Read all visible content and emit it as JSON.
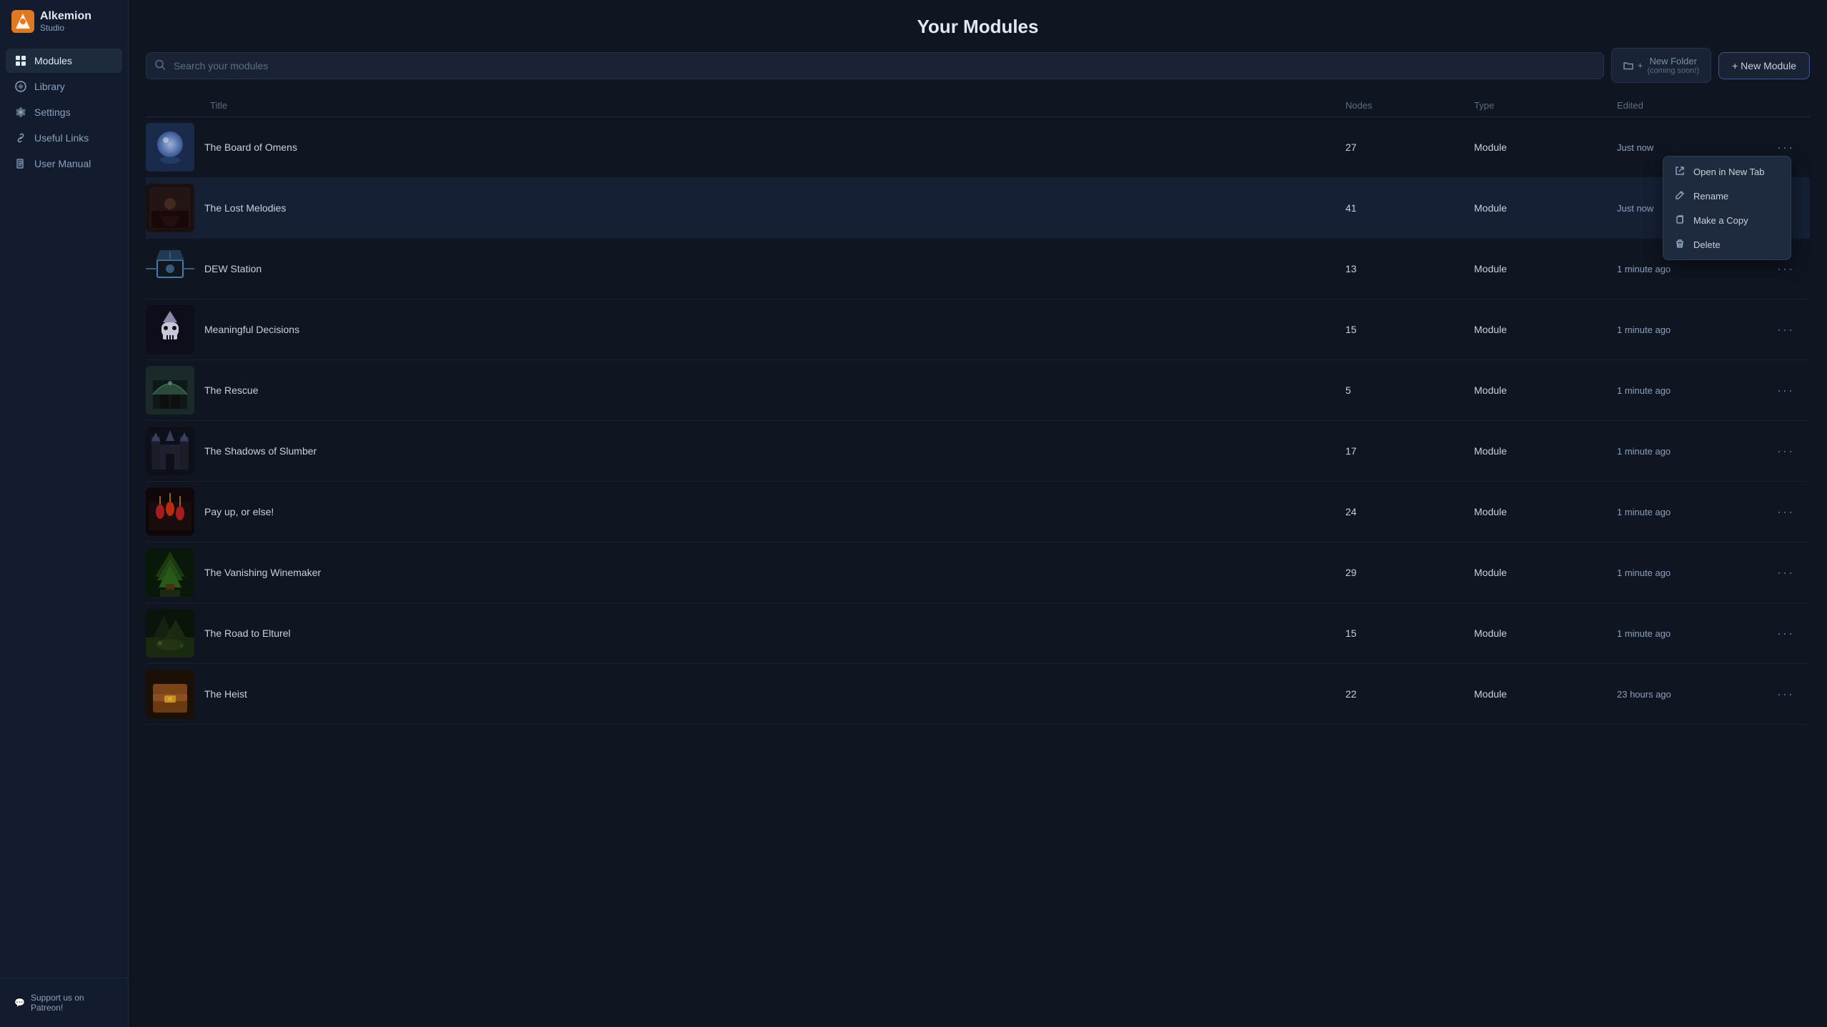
{
  "app": {
    "name": "Alkemion",
    "subtitle": "Studio"
  },
  "sidebar": {
    "items": [
      {
        "id": "modules",
        "label": "Modules",
        "icon": "⊞",
        "active": true
      },
      {
        "id": "library",
        "label": "Library",
        "icon": "📚",
        "active": false
      },
      {
        "id": "settings",
        "label": "Settings",
        "icon": "⚙",
        "active": false
      },
      {
        "id": "useful-links",
        "label": "Useful Links",
        "icon": "🔗",
        "active": false
      },
      {
        "id": "user-manual",
        "label": "User Manual",
        "icon": "📖",
        "active": false
      }
    ],
    "support_label": "Support us on Patreon!"
  },
  "page": {
    "title": "Your Modules"
  },
  "search": {
    "placeholder": "Search your modules"
  },
  "toolbar": {
    "new_folder_label": "New Folder",
    "new_folder_sublabel": "(coming soon!)",
    "new_module_label": "+ New Module"
  },
  "table": {
    "columns": [
      "Title",
      "Nodes",
      "Type",
      "Edited"
    ],
    "rows": [
      {
        "id": 1,
        "title": "The Board of Omens",
        "nodes": 27,
        "type": "Module",
        "edited": "Just now",
        "thumb_type": "crystal_ball",
        "selected": false
      },
      {
        "id": 2,
        "title": "The Lost Melodies",
        "nodes": 41,
        "type": "Module",
        "edited": "Just now",
        "thumb_type": "photo_dark",
        "selected": true
      },
      {
        "id": 3,
        "title": "DEW Station",
        "nodes": 13,
        "type": "Module",
        "edited": "1 minute ago",
        "thumb_type": "satellite",
        "selected": false
      },
      {
        "id": 4,
        "title": "Meaningful Decisions",
        "nodes": 15,
        "type": "Module",
        "edited": "1 minute ago",
        "thumb_type": "skull_crown",
        "selected": false
      },
      {
        "id": 5,
        "title": "The Rescue",
        "nodes": 5,
        "type": "Module",
        "edited": "1 minute ago",
        "thumb_type": "gate_arch",
        "selected": false
      },
      {
        "id": 6,
        "title": "The Shadows of Slumber",
        "nodes": 17,
        "type": "Module",
        "edited": "1 minute ago",
        "thumb_type": "dark_castle",
        "selected": false
      },
      {
        "id": 7,
        "title": "Pay up, or else!",
        "nodes": 24,
        "type": "Module",
        "edited": "1 minute ago",
        "thumb_type": "red_lanterns",
        "selected": false
      },
      {
        "id": 8,
        "title": "The Vanishing Winemaker",
        "nodes": 29,
        "type": "Module",
        "edited": "1 minute ago",
        "thumb_type": "forest_path",
        "selected": false
      },
      {
        "id": 9,
        "title": "The Road to Elturel",
        "nodes": 15,
        "type": "Module",
        "edited": "1 minute ago",
        "thumb_type": "swamp_path",
        "selected": false
      },
      {
        "id": 10,
        "title": "The Heist",
        "nodes": 22,
        "type": "Module",
        "edited": "23 hours ago",
        "thumb_type": "treasure_chest",
        "selected": false
      }
    ]
  },
  "context_menu": {
    "visible": true,
    "row_id": 2,
    "items": [
      {
        "id": "open-new-tab",
        "label": "Open in New Tab",
        "icon": "external"
      },
      {
        "id": "rename",
        "label": "Rename",
        "icon": "pencil"
      },
      {
        "id": "make-copy",
        "label": "Make a Copy",
        "icon": "copy"
      },
      {
        "id": "delete",
        "label": "Delete",
        "icon": "trash"
      }
    ]
  }
}
